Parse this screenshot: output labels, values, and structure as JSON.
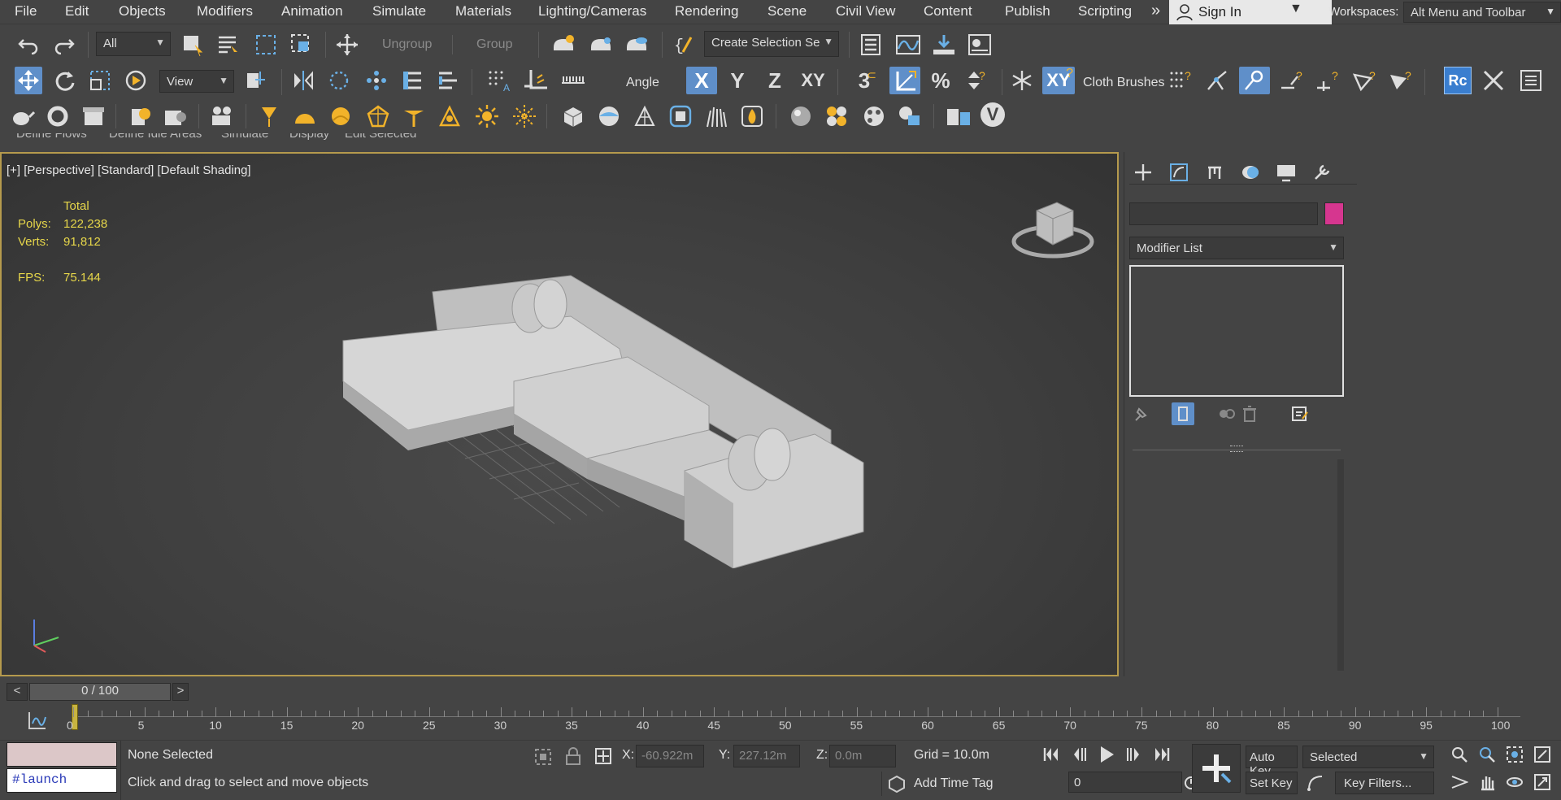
{
  "menu": {
    "items": [
      "File",
      "Edit",
      "Objects",
      "Modifiers",
      "Animation",
      "Simulate",
      "Materials",
      "Lighting/Cameras",
      "Rendering",
      "Scene",
      "Civil View",
      "Content",
      "Publish",
      "Scripting"
    ],
    "overflow_glyph": "»",
    "sign_in": "Sign In",
    "workspaces_label": "Workspaces:",
    "workspace_value": "Alt Menu and Toolbar"
  },
  "toolbar1": {
    "selection_filter": "All",
    "ungroup_label": "Ungroup",
    "group_label": "Group",
    "named_selection": "Create Selection Se"
  },
  "toolbar2": {
    "ref_coord": "View",
    "angle_label": "Angle",
    "axis_x": "X",
    "axis_y": "Y",
    "axis_z": "Z",
    "axis_xy": "XY",
    "snap_3": "3",
    "cloth_brushes": "Cloth Brushes"
  },
  "ribbon_tabs": [
    "Define Flows",
    "Define Idle Areas",
    "Simulate",
    "Display",
    "Edit Selected"
  ],
  "viewport": {
    "label": "[+] [Perspective] [Standard] [Default Shading]",
    "stats_total": "Total",
    "polys_label": "Polys:",
    "polys_value": "122,238",
    "verts_label": "Verts:",
    "verts_value": "91,812",
    "fps_label": "FPS:",
    "fps_value": "75.144"
  },
  "command_panel": {
    "modifier_list": "Modifier List",
    "color_swatch": "#d6368f"
  },
  "timeline": {
    "frame_display": "0 / 100",
    "prev": "<",
    "next": ">",
    "ticks": [
      "0",
      "5",
      "10",
      "15",
      "20",
      "25",
      "30",
      "35",
      "40",
      "45",
      "50",
      "55",
      "60",
      "65",
      "70",
      "75",
      "80",
      "85",
      "90",
      "95",
      "100"
    ]
  },
  "status": {
    "script_value": "#launch",
    "selection_status": "None Selected",
    "prompt": "Click and drag to select and move objects",
    "x_label": "X:",
    "x_value": "-60.922m",
    "y_label": "Y:",
    "y_value": "227.12m",
    "z_label": "Z:",
    "z_value": "0.0m",
    "grid": "Grid = 10.0m",
    "add_time_tag": "Add Time Tag",
    "auto_key": "Auto Key",
    "set_key": "Set Key",
    "key_mode": "Selected",
    "key_filters": "Key Filters...",
    "current_frame": "0"
  },
  "colors": {
    "accent_blue": "#5f8fc9",
    "viewport_border": "#b59a4d",
    "stats_yellow": "#e6d64a",
    "icon_orange": "#f2b32a"
  }
}
